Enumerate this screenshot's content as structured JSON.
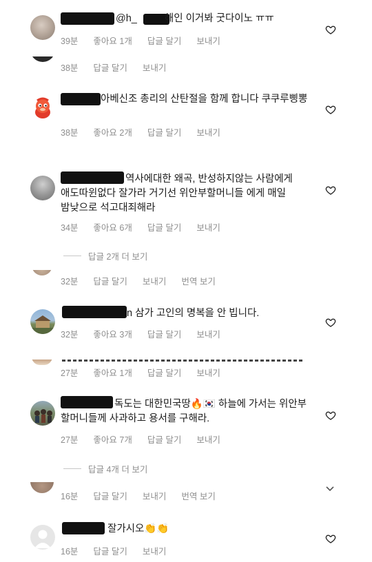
{
  "comments": [
    {
      "id": "c1",
      "text": "해인 이거봐 굿다이노 ㅠㅠ",
      "prefix": "@h_",
      "time": "39분",
      "likes": "좋아요 1개",
      "reply": "답글 달기",
      "send": "보내기"
    },
    {
      "id": "c2",
      "text": "아베신조 총리의 산탄절을 함께 합니다 쿠쿠루삥뽕",
      "time": "38분",
      "likes": "좋아요 2개",
      "reply": "답글 달기",
      "send": "보내기"
    },
    {
      "id": "c3",
      "text": "역사에대한 왜곡, 반성하지않는 사람에게 애도따윈없다 잘가라 거기선 위안부할머니들 에게 매일 밤낮으로 석고대죄해라",
      "time": "34분",
      "likes": "좋아요 6개",
      "reply": "답글 달기",
      "send": "보내기",
      "more_replies": "답글 2개 더 보기"
    },
    {
      "id": "c4",
      "text": "삼가 고인의 명복을 안 빕니다.",
      "prefix": "n",
      "time": "32분",
      "likes": "좋아요 3개",
      "reply": "답글 달기",
      "send": "보내기"
    },
    {
      "id": "c5",
      "text": "독도는 대한민국땅🔥🇰🇷 하늘에 가서는 위안부 할머니들께 사과하고 용서를 구해라.",
      "time": "27분",
      "likes": "좋아요 7개",
      "reply": "답글 달기",
      "send": "보내기",
      "more_replies": "답글 4개 더 보기"
    },
    {
      "id": "c6",
      "text": "잘가시오👏👏",
      "time": "16분",
      "reply": "답글 달기",
      "send": "보내기"
    }
  ],
  "slivers": {
    "s1": {
      "time": "38분",
      "reply": "답글 달기",
      "send": "보내기"
    },
    "s2": {
      "time": "32분",
      "reply": "답글 달기",
      "send": "보내기",
      "translate": "번역 보기"
    },
    "s3": {
      "time": "27분",
      "likes": "좋아요 1개",
      "reply": "답글 달기",
      "send": "보내기"
    },
    "s4": {
      "time": "16분",
      "reply": "답글 달기",
      "send": "보내기",
      "translate": "번역 보기"
    }
  },
  "icons": {
    "like": "heart-outline-icon",
    "collapse": "chevron-down-icon"
  },
  "colors": {
    "meta": "#8e8e8e",
    "text": "#1c1c1c",
    "redaction": "#111111"
  }
}
